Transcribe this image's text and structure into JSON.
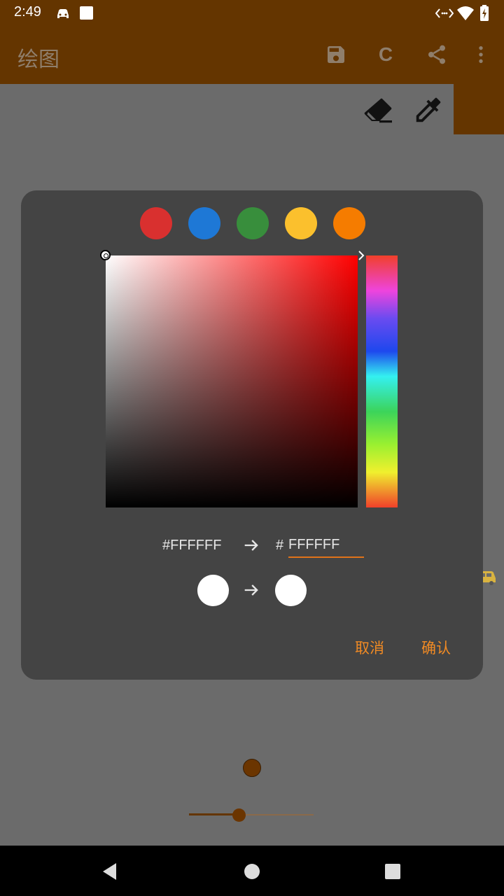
{
  "status_bar": {
    "time": "2:49"
  },
  "app_bar": {
    "title": "绘图",
    "clear_label": "C"
  },
  "dialog": {
    "presets": [
      {
        "name": "red",
        "color": "#d9302f"
      },
      {
        "name": "blue",
        "color": "#1e78d6"
      },
      {
        "name": "green",
        "color": "#388e3c"
      },
      {
        "name": "yellow",
        "color": "#fbc02d"
      },
      {
        "name": "orange",
        "color": "#f57c00"
      }
    ],
    "old_hex": "#FFFFFF",
    "hex_prefix": "#",
    "new_hex": "FFFFFF",
    "old_color": "#FFFFFF",
    "new_color": "#FFFFFF",
    "cancel_label": "取消",
    "confirm_label": "确认"
  },
  "colors": {
    "app_bar": "#643500",
    "accent": "#f08a24",
    "brush": "#6b3500"
  }
}
